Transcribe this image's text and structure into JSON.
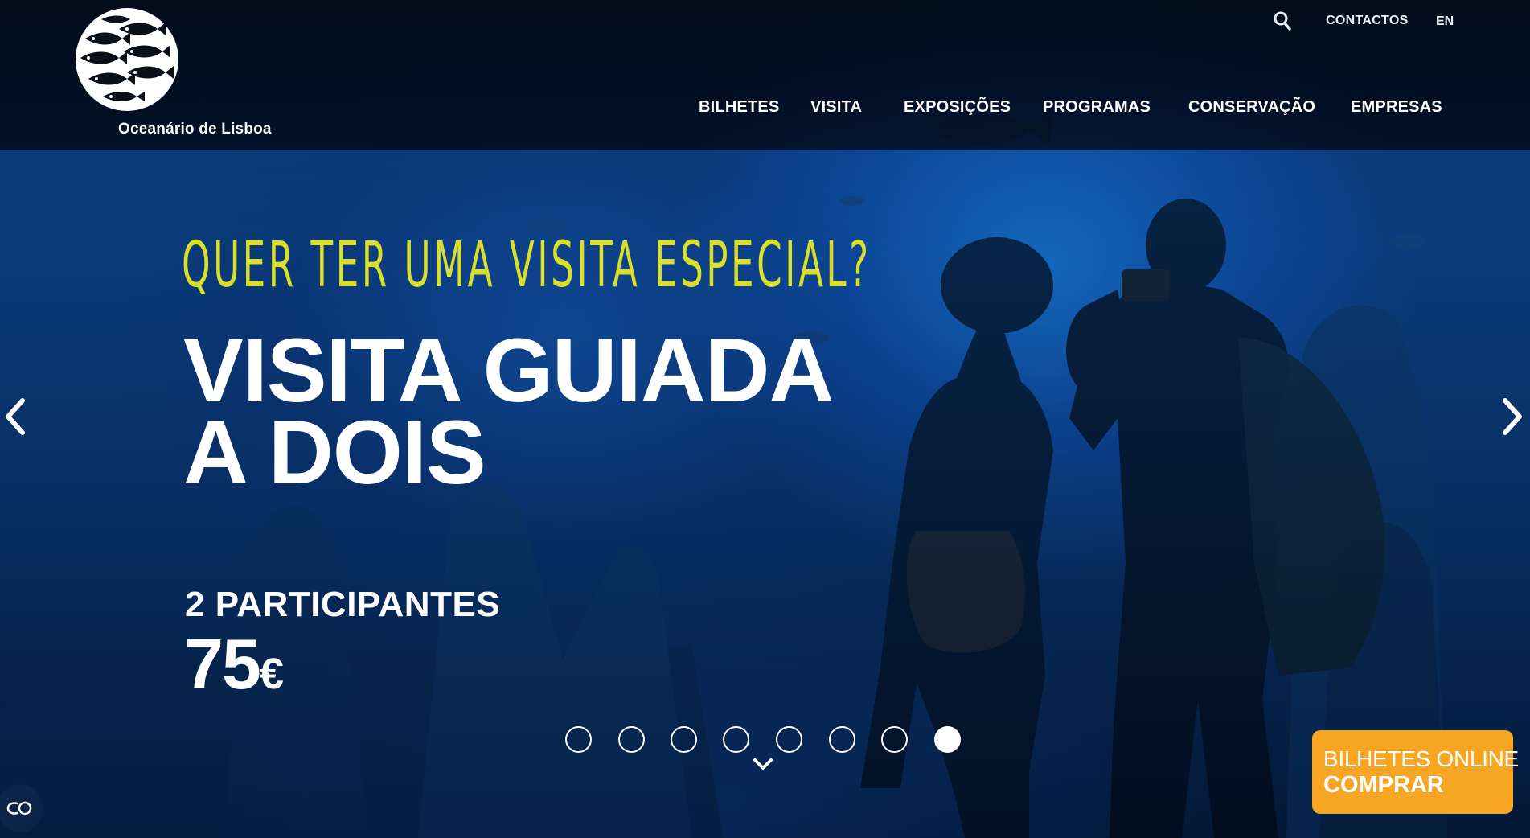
{
  "brand": {
    "name": "Oceanário de Lisboa",
    "logo_icon": "fish-school-logo-icon"
  },
  "utility_nav": {
    "search_icon": "search-icon",
    "contacts_label": "CONTACTOS",
    "language_label": "EN"
  },
  "main_nav": {
    "items": [
      {
        "label": "BILHETES"
      },
      {
        "label": "VISITA"
      },
      {
        "label": "EXPOSIÇÕES"
      },
      {
        "label": "PROGRAMAS"
      },
      {
        "label": "CONSERVAÇÃO"
      },
      {
        "label": "EMPRESAS"
      }
    ]
  },
  "slide": {
    "kicker": "QUER TER UMA VISITA ESPECIAL?",
    "headline_line1": "VISITA GUIADA",
    "headline_line2": "A DOIS",
    "participants": "2 PARTICIPANTES",
    "price_amount": "75",
    "price_currency": "€"
  },
  "carousel": {
    "slide_count": 8,
    "active_index": 7,
    "prev_icon": "chevron-left-icon",
    "next_icon": "chevron-right-icon",
    "scroll_icon": "chevron-down-icon"
  },
  "cta": {
    "line1": "BILHETES ONLINE",
    "line2": "COMPRAR",
    "color": "#f6a623"
  },
  "accessibility": {
    "icon": "accessibility-toggle-icon"
  },
  "colors": {
    "kicker": "#d9df2a",
    "header_bg": "#020c1c",
    "ocean": "#073068"
  }
}
